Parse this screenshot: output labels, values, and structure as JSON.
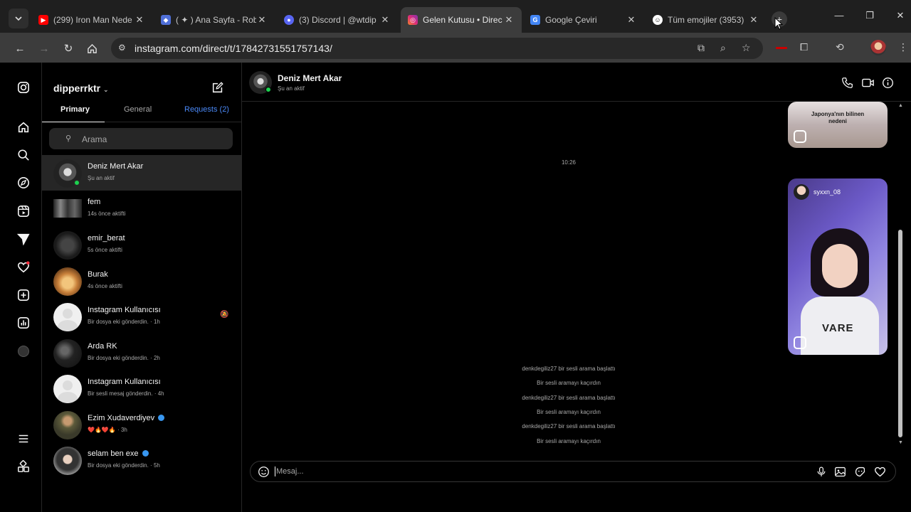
{
  "browser": {
    "tabs": [
      {
        "title": "(299) Iron Man Nede",
        "favicon": "youtube-icon",
        "color": "#ff0000"
      },
      {
        "title": "( ✦ ) Ana Sayfa - Rob",
        "favicon": "roblox-icon",
        "color": "#4f6fd8"
      },
      {
        "title": "(3) Discord | @wtdip",
        "favicon": "discord-icon",
        "color": "#5865f2"
      },
      {
        "title": "Gelen Kutusu • Direc",
        "favicon": "instagram-icon",
        "color": "#dd2a7b"
      },
      {
        "title": "Google Çeviri",
        "favicon": "translate-icon",
        "color": "#4285f4"
      },
      {
        "title": "Tüm emojiler (3953)",
        "favicon": "emoji-icon",
        "color": "#ffffff"
      }
    ],
    "url": "instagram.com/direct/t/17842731551757143/"
  },
  "inbox": {
    "username": "dipperrktr",
    "tabs": [
      "Primary",
      "General",
      "Requests (2)"
    ],
    "search_placeholder": "Arama",
    "conversations": [
      {
        "name": "Deniz Mert Akar",
        "status": "Şu an aktif",
        "online": true
      },
      {
        "name": "fem",
        "status": "14s önce aktifti"
      },
      {
        "name": "emir_berat",
        "status": "5s önce aktifti"
      },
      {
        "name": "Burak",
        "status": "4s önce aktifti"
      },
      {
        "name": "Instagram Kullanıcısı",
        "status": "Bir dosya eki gönderdin. · 1h",
        "muted": true
      },
      {
        "name": "Arda RK",
        "status": "Bir dosya eki gönderdin. · 2h"
      },
      {
        "name": "Instagram Kullanıcısı",
        "status": "Bir sesli mesaj gönderdin. · 4h"
      },
      {
        "name": "Ezim Xudaverdiyev",
        "status": "❤️🔥❤️🔥 · 3h",
        "verified": true
      },
      {
        "name": "selam ben exe",
        "status": "Bir dosya eki gönderdin. · 5h",
        "verified": true
      }
    ]
  },
  "chat": {
    "name": "Deniz Mert Akar",
    "status": "Şu an aktif",
    "reel_caption": "Japonya'nın bilinen nedeni",
    "timestamp": "10:26",
    "reel_author": "syxxn_08",
    "system_messages": [
      "denkdegiliz27 bir sesli arama başlattı",
      "Bir sesli aramayı kaçırdın",
      "denkdegiliz27 bir sesli arama başlattı",
      "Bir sesli aramayı kaçırdın",
      "denkdegiliz27 bir sesli arama başlattı",
      "Bir sesli aramayı kaçırdın"
    ],
    "composer_placeholder": "Mesaj..."
  }
}
